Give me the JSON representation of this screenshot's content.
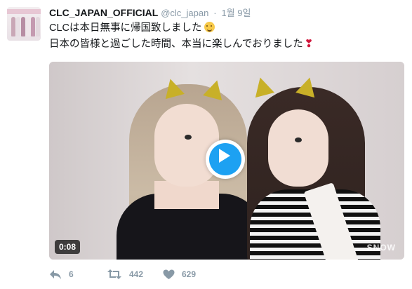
{
  "tweet": {
    "display_name": "CLC_JAPAN_OFFICIAL",
    "handle": "@clc_japan",
    "separator": "·",
    "timestamp": "1월 9일",
    "text_line1": "CLCは本日無事に帰国致しました",
    "text_line2": "日本の皆様と過ごした時間、本当に楽しんでおりました",
    "line2_emoji": "❣"
  },
  "media": {
    "type": "video",
    "duration": "0:08",
    "watermark": "SNOW"
  },
  "actions": {
    "reply_count": "6",
    "retweet_count": "442",
    "like_count": "629"
  },
  "colors": {
    "accent": "#1da1f2",
    "meta": "#8899a6",
    "text": "#14171a",
    "heart_emoji": "#d0163b"
  },
  "icons": [
    "reply-icon",
    "retweet-icon",
    "heart-icon",
    "play-icon",
    "hugging-face-emoji",
    "heart-exclamation-emoji"
  ]
}
